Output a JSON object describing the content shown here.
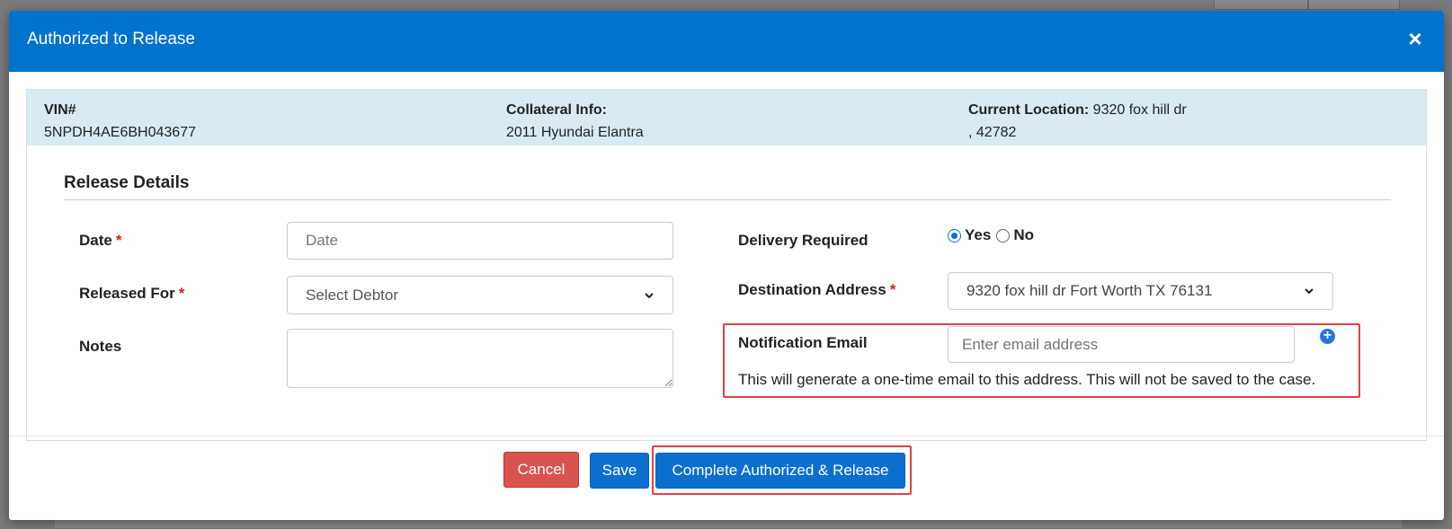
{
  "modal": {
    "title": "Authorized to Release",
    "close_icon": "close-icon"
  },
  "info": {
    "vin_label": "VIN#",
    "vin_value": "5NPDH4AE6BH043677",
    "collateral_label": "Collateral Info:",
    "collateral_value": "2011 Hyundai Elantra",
    "location_label": "Current Location:",
    "location_value_line1": " 9320 fox hill dr",
    "location_value_line2": ", 42782"
  },
  "section": {
    "title": "Release Details"
  },
  "form": {
    "date_label": "Date",
    "date_placeholder": "Date",
    "released_for_label": "Released For",
    "released_for_value": "Select Debtor",
    "notes_label": "Notes",
    "notes_value": "",
    "delivery_label": "Delivery Required",
    "delivery_yes": "Yes",
    "delivery_no": "No",
    "delivery_selected": "Yes",
    "destination_label": "Destination Address",
    "destination_value": "9320 fox hill dr Fort Worth TX 76131",
    "email_label": "Notification Email",
    "email_placeholder": "Enter email address",
    "email_help": "This will generate a one-time email to this address. This will not be saved to the case.",
    "required_marker": "*",
    "add_email_icon": "plus-circle-icon",
    "dropdown_icon": "chevron-down-icon"
  },
  "footer": {
    "cancel_label": "Cancel",
    "save_label": "Save",
    "complete_label": "Complete Authorized & Release"
  },
  "colors": {
    "header_bg": "#0073cf",
    "info_bg": "#d9eaf2",
    "cancel_bg": "#d9534f",
    "primary_bg": "#0b6fd0",
    "highlight": "#e04146",
    "required": "#d9201f"
  }
}
